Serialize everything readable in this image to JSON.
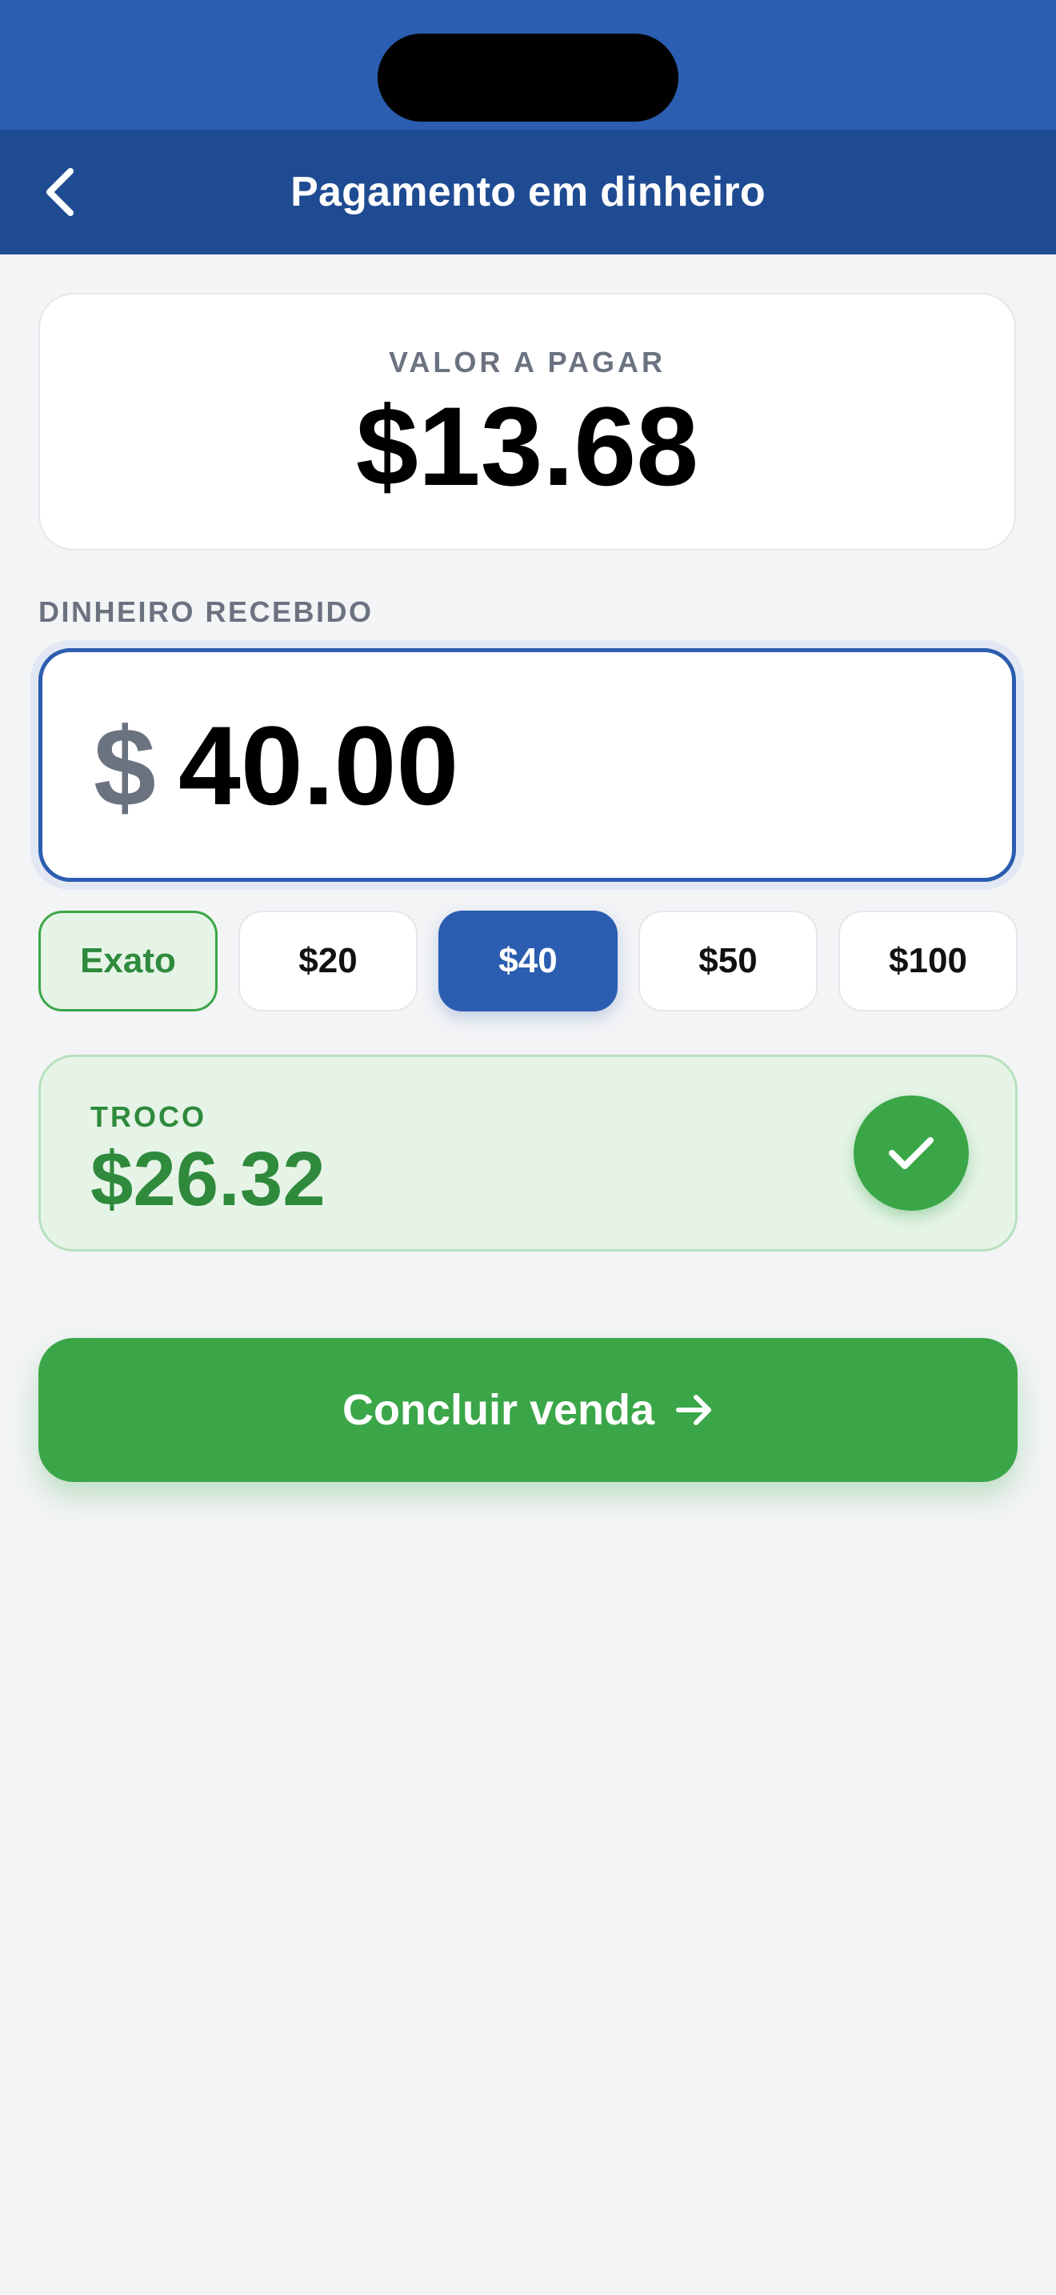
{
  "header": {
    "title": "Pagamento em dinheiro",
    "back_icon": "chevron-left-icon"
  },
  "amount_due": {
    "label": "VALOR A PAGAR",
    "value": "$13.68"
  },
  "cash_received": {
    "label": "DINHEIRO RECEBIDO",
    "currency_symbol": "$",
    "value": "40.00"
  },
  "quick_amounts": [
    {
      "label": "Exato",
      "state": "exact"
    },
    {
      "label": "$20",
      "state": "default"
    },
    {
      "label": "$40",
      "state": "selected"
    },
    {
      "label": "$50",
      "state": "default"
    },
    {
      "label": "$100",
      "state": "default"
    }
  ],
  "change": {
    "label": "TROCO",
    "value": "$26.32",
    "icon": "check-icon"
  },
  "complete_button": {
    "label": "Concluir venda",
    "icon": "arrow-right-icon"
  },
  "colors": {
    "primary_blue": "#2b5db0",
    "nav_blue": "#1f4b92",
    "success_green": "#3aa648",
    "change_text_green": "#2f8a3c",
    "background": "#f3f4f6"
  }
}
